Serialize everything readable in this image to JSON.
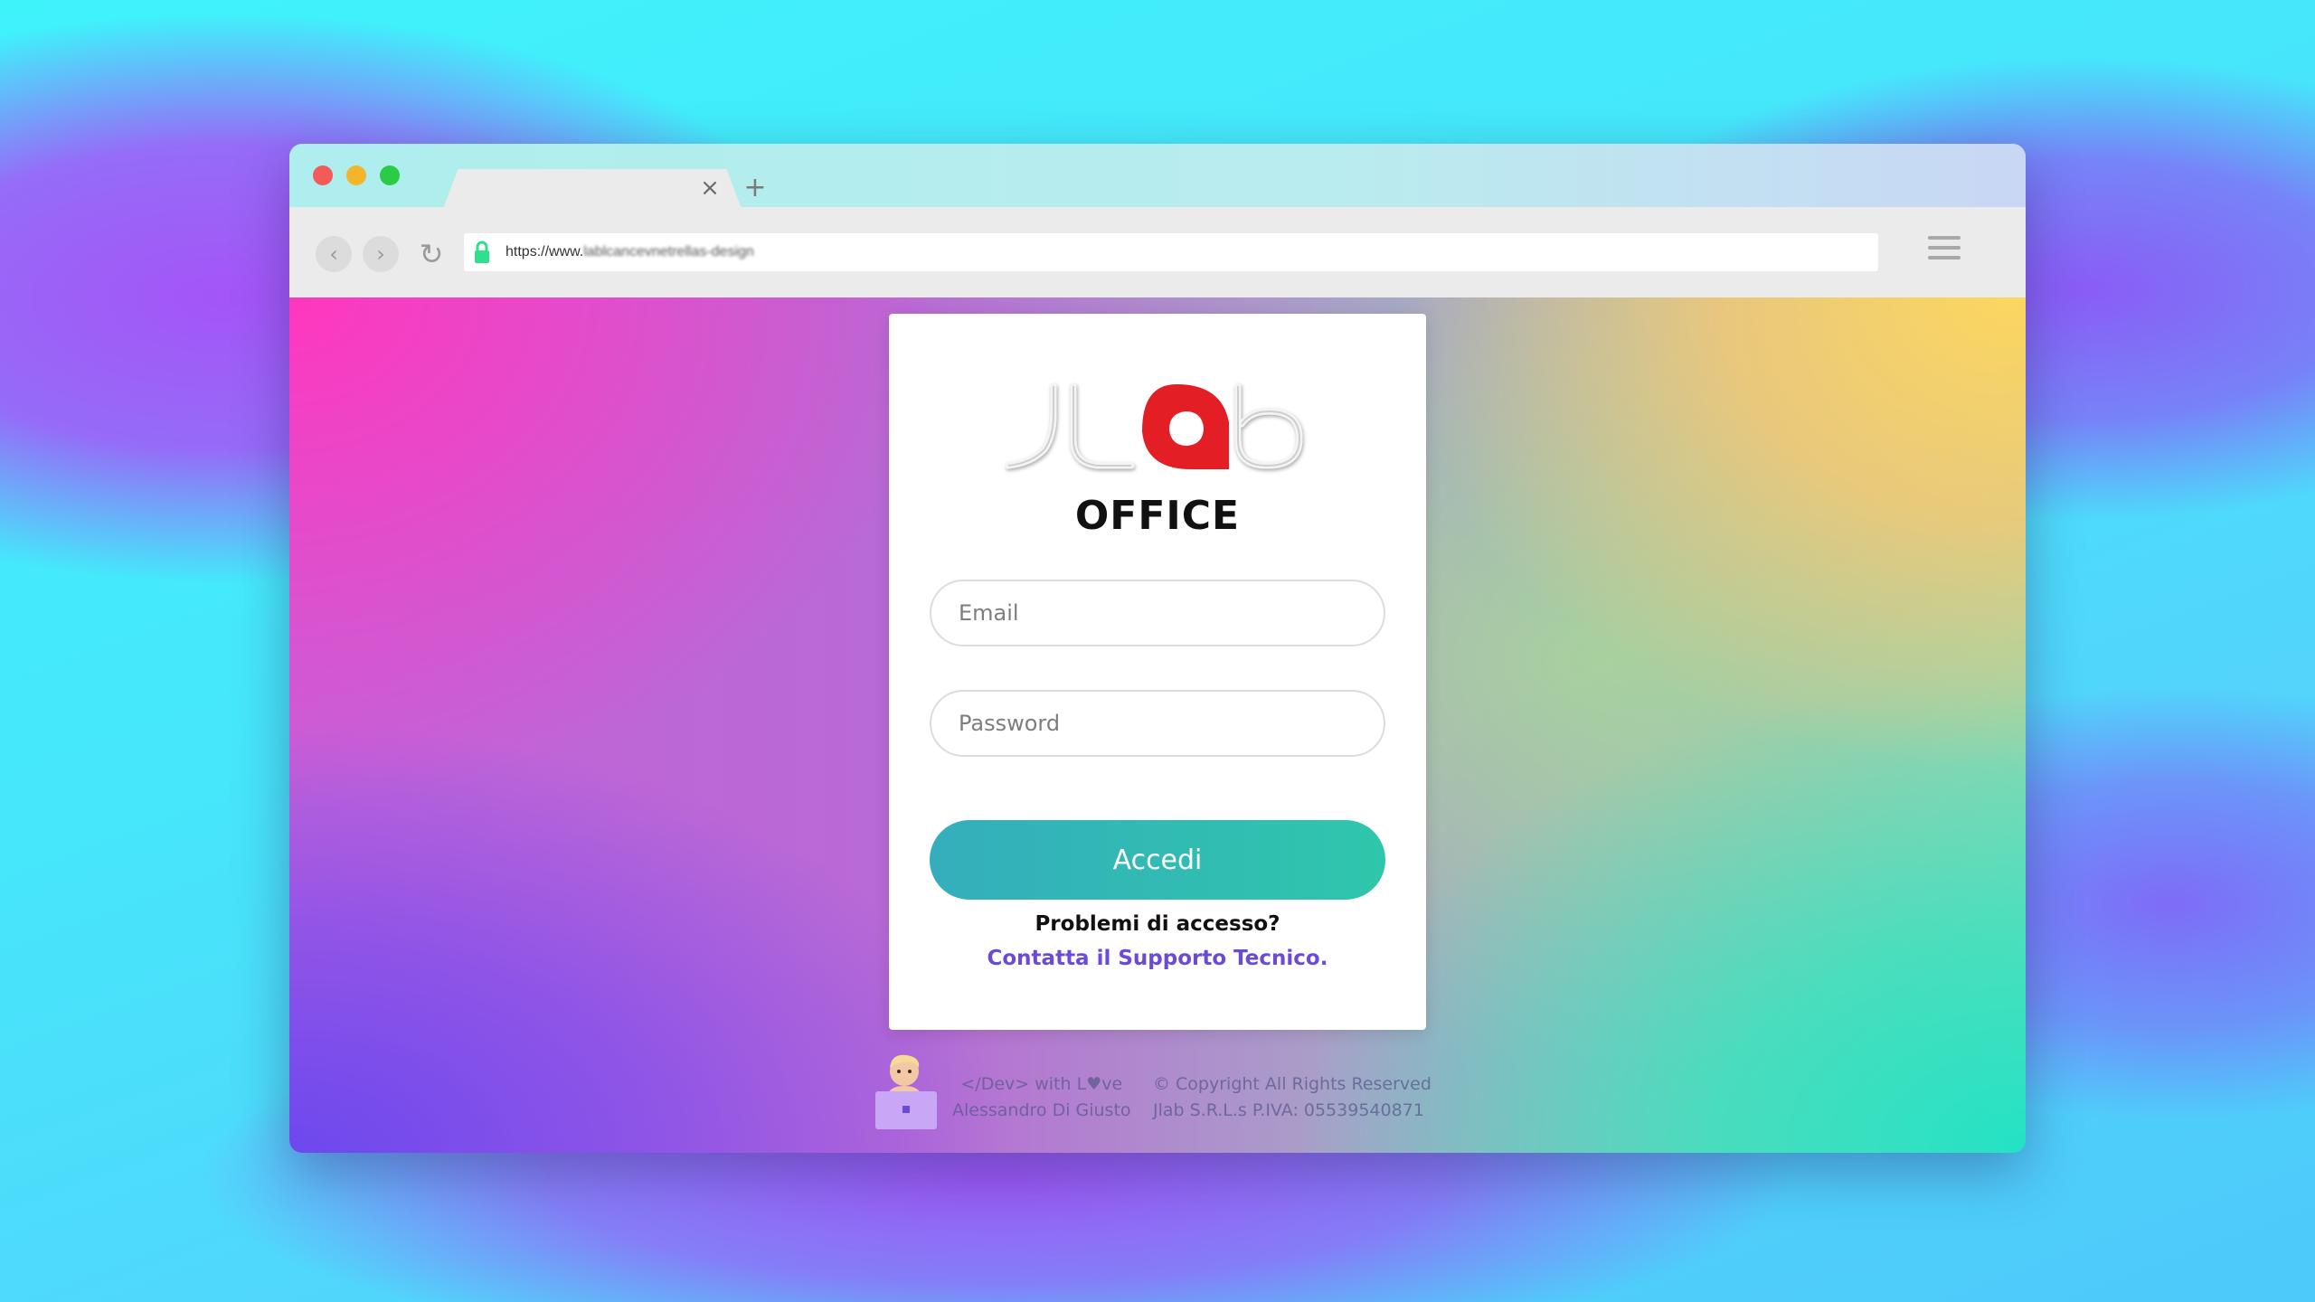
{
  "browser": {
    "new_tab_glyph": "+",
    "close_tab_glyph": "×",
    "url_prefix": "https://www.",
    "url_blurred": "lablcancevnetrellas-design"
  },
  "login": {
    "brand_title": "OFFICE",
    "email_placeholder": "Email",
    "password_placeholder": "Password",
    "submit_label": "Accedi",
    "problem_text": "Problemi di accesso?",
    "support_link": "Contatta il Supporto Tecnico."
  },
  "footer": {
    "dev_line": "</Dev> with L♥ve",
    "dev_name": "Alessandro Di Giusto",
    "copyright": "© Copyright All Rights Reserved",
    "company": "Jlab S.R.L.s  P.IVA: 05539540871"
  },
  "colors": {
    "accent_button_start": "#34aebc",
    "accent_button_end": "#2fc6ab",
    "link": "#6a4ad6",
    "logo_red": "#e31e24"
  },
  "icons": [
    "back-arrow-icon",
    "forward-arrow-icon",
    "reload-icon",
    "lock-icon",
    "hamburger-menu-icon",
    "close-icon",
    "plus-icon",
    "jlab-logo",
    "developer-avatar"
  ]
}
